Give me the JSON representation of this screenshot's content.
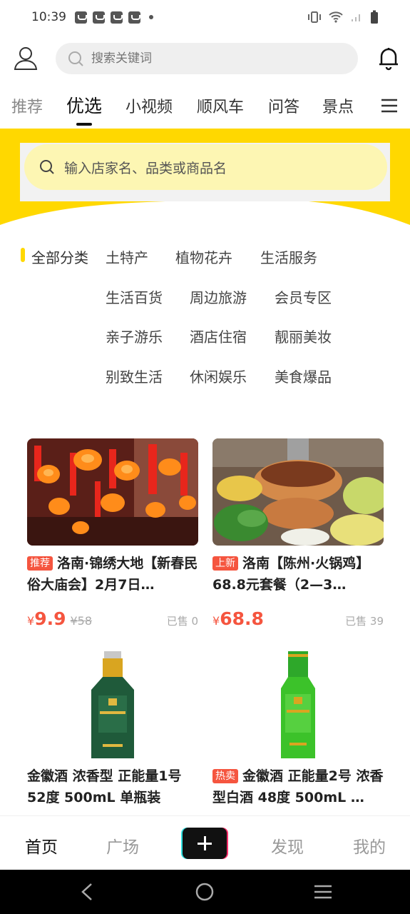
{
  "status_bar": {
    "time": "10:39"
  },
  "top_bar": {
    "search_placeholder": "搜索关键词"
  },
  "tabs": [
    "推荐",
    "优选",
    "小视频",
    "顺风车",
    "问答",
    "景点"
  ],
  "active_tab_index": 1,
  "store_search": {
    "placeholder": "输入店家名、品类或商品名"
  },
  "categories": {
    "all_label": "全部分类",
    "items": [
      "土特产",
      "植物花卉",
      "生活服务",
      "生活百货",
      "周边旅游",
      "会员专区",
      "亲子游乐",
      "酒店住宿",
      "靓丽美妆",
      "别致生活",
      "休闲娱乐",
      "美食爆品"
    ]
  },
  "products": [
    {
      "tag": "推荐",
      "title": "洛南·锦绣大地【新春民俗大庙会】2月7日…",
      "price_symbol": "¥",
      "price": "9.9",
      "original_price": "¥58",
      "sold": "已售 0",
      "image_icon": "lanterns-image"
    },
    {
      "tag": "上新",
      "title": "洛南【陈州·火锅鸡】68.8元套餐（2—3…",
      "price_symbol": "¥",
      "price": "68.8",
      "sold": "已售 39",
      "image_icon": "hotpot-image"
    },
    {
      "title": "金徽酒 浓香型 正能量1号 52度 500mL 单瓶装",
      "image_icon": "dark-green-bottle-image",
      "bottle_color": "#1f5a3a"
    },
    {
      "tag": "热卖",
      "title": "金徽酒 正能量2号 浓香型白酒 48度 500mL …",
      "image_icon": "green-bottle-image",
      "bottle_color": "#3cc22a"
    }
  ],
  "bottom_nav": {
    "items": [
      "首页",
      "广场",
      "发现",
      "我的"
    ],
    "active_index": 0
  },
  "colors": {
    "brand_yellow": "#ffd800",
    "price_red": "#f5553f"
  }
}
